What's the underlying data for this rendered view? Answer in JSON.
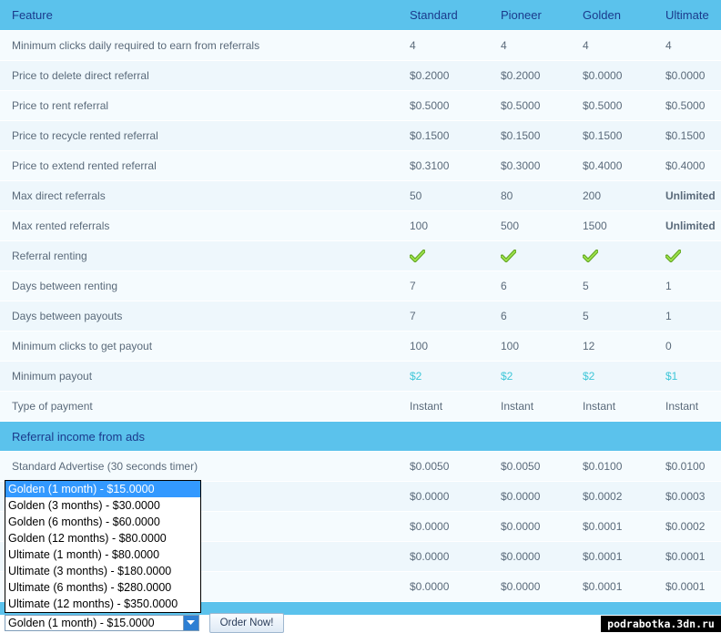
{
  "table": {
    "headers": [
      "Feature",
      "Standard",
      "Pioneer",
      "Golden",
      "Ultimate"
    ],
    "rows": [
      {
        "label": "Minimum clicks daily required to earn from referrals",
        "values": [
          "4",
          "4",
          "4",
          "4"
        ]
      },
      {
        "label": "Price to delete direct referral",
        "values": [
          "$0.2000",
          "$0.2000",
          "$0.0000",
          "$0.0000"
        ]
      },
      {
        "label": "Price to rent referral",
        "values": [
          "$0.5000",
          "$0.5000",
          "$0.5000",
          "$0.5000"
        ]
      },
      {
        "label": "Price to recycle rented referral",
        "values": [
          "$0.1500",
          "$0.1500",
          "$0.1500",
          "$0.1500"
        ]
      },
      {
        "label": "Price to extend rented referral",
        "values": [
          "$0.3100",
          "$0.3000",
          "$0.4000",
          "$0.4000"
        ]
      },
      {
        "label": "Max direct referrals",
        "values": [
          "50",
          "80",
          "200",
          "Unlimited"
        ]
      },
      {
        "label": "Max rented referrals",
        "values": [
          "100",
          "500",
          "1500",
          "Unlimited"
        ]
      },
      {
        "label": "Referral renting",
        "values": [
          "check",
          "check",
          "check",
          "check"
        ]
      },
      {
        "label": "Days between renting",
        "values": [
          "7",
          "6",
          "5",
          "1"
        ]
      },
      {
        "label": "Days between payouts",
        "values": [
          "7",
          "6",
          "5",
          "1"
        ]
      },
      {
        "label": "Minimum clicks to get payout",
        "values": [
          "100",
          "100",
          "12",
          "0"
        ]
      },
      {
        "label": "Minimum payout",
        "values": [
          "$2",
          "$2",
          "$2",
          "$1"
        ]
      },
      {
        "label": "Type of payment",
        "values": [
          "Instant",
          "Instant",
          "Instant",
          "Instant"
        ]
      }
    ],
    "section_title": "Referral income from ads",
    "ad_rows": [
      {
        "label": "Standard Advertise (30 seconds timer)",
        "values": [
          "$0.0050",
          "$0.0050",
          "$0.0100",
          "$0.0100"
        ]
      },
      {
        "label": "",
        "values": [
          "$0.0000",
          "$0.0000",
          "$0.0002",
          "$0.0003"
        ]
      },
      {
        "label": "",
        "values": [
          "$0.0000",
          "$0.0000",
          "$0.0001",
          "$0.0002"
        ]
      },
      {
        "label": "",
        "values": [
          "$0.0000",
          "$0.0000",
          "$0.0001",
          "$0.0001"
        ]
      },
      {
        "label": "",
        "values": [
          "$0.0000",
          "$0.0000",
          "$0.0001",
          "$0.0001"
        ]
      }
    ]
  },
  "upgrade": {
    "options": [
      "Golden (1 month) - $15.0000",
      "Golden (3 months) - $30.0000",
      "Golden (6 months) - $60.0000",
      "Golden (12 months) - $80.0000",
      "Ultimate (1 month) - $80.0000",
      "Ultimate (3 months) - $180.0000",
      "Ultimate (6 months) - $280.0000",
      "Ultimate (12 months) - $350.0000"
    ],
    "selected": "Golden (1 month) - $15.0000",
    "order_label": "Order Now!"
  },
  "watermark": "podrabotka.3dn.ru",
  "colors": {
    "header_bg": "#5bc2ec",
    "header_text": "#1b3a8c",
    "row_bg": "#eef7fc",
    "check_green": "#7cc62a",
    "payout_teal": "#3ec6d8",
    "select_highlight": "#3399ff"
  },
  "icons": {
    "check": "green-checkmark-icon",
    "dropdown": "chevron-down-icon"
  }
}
